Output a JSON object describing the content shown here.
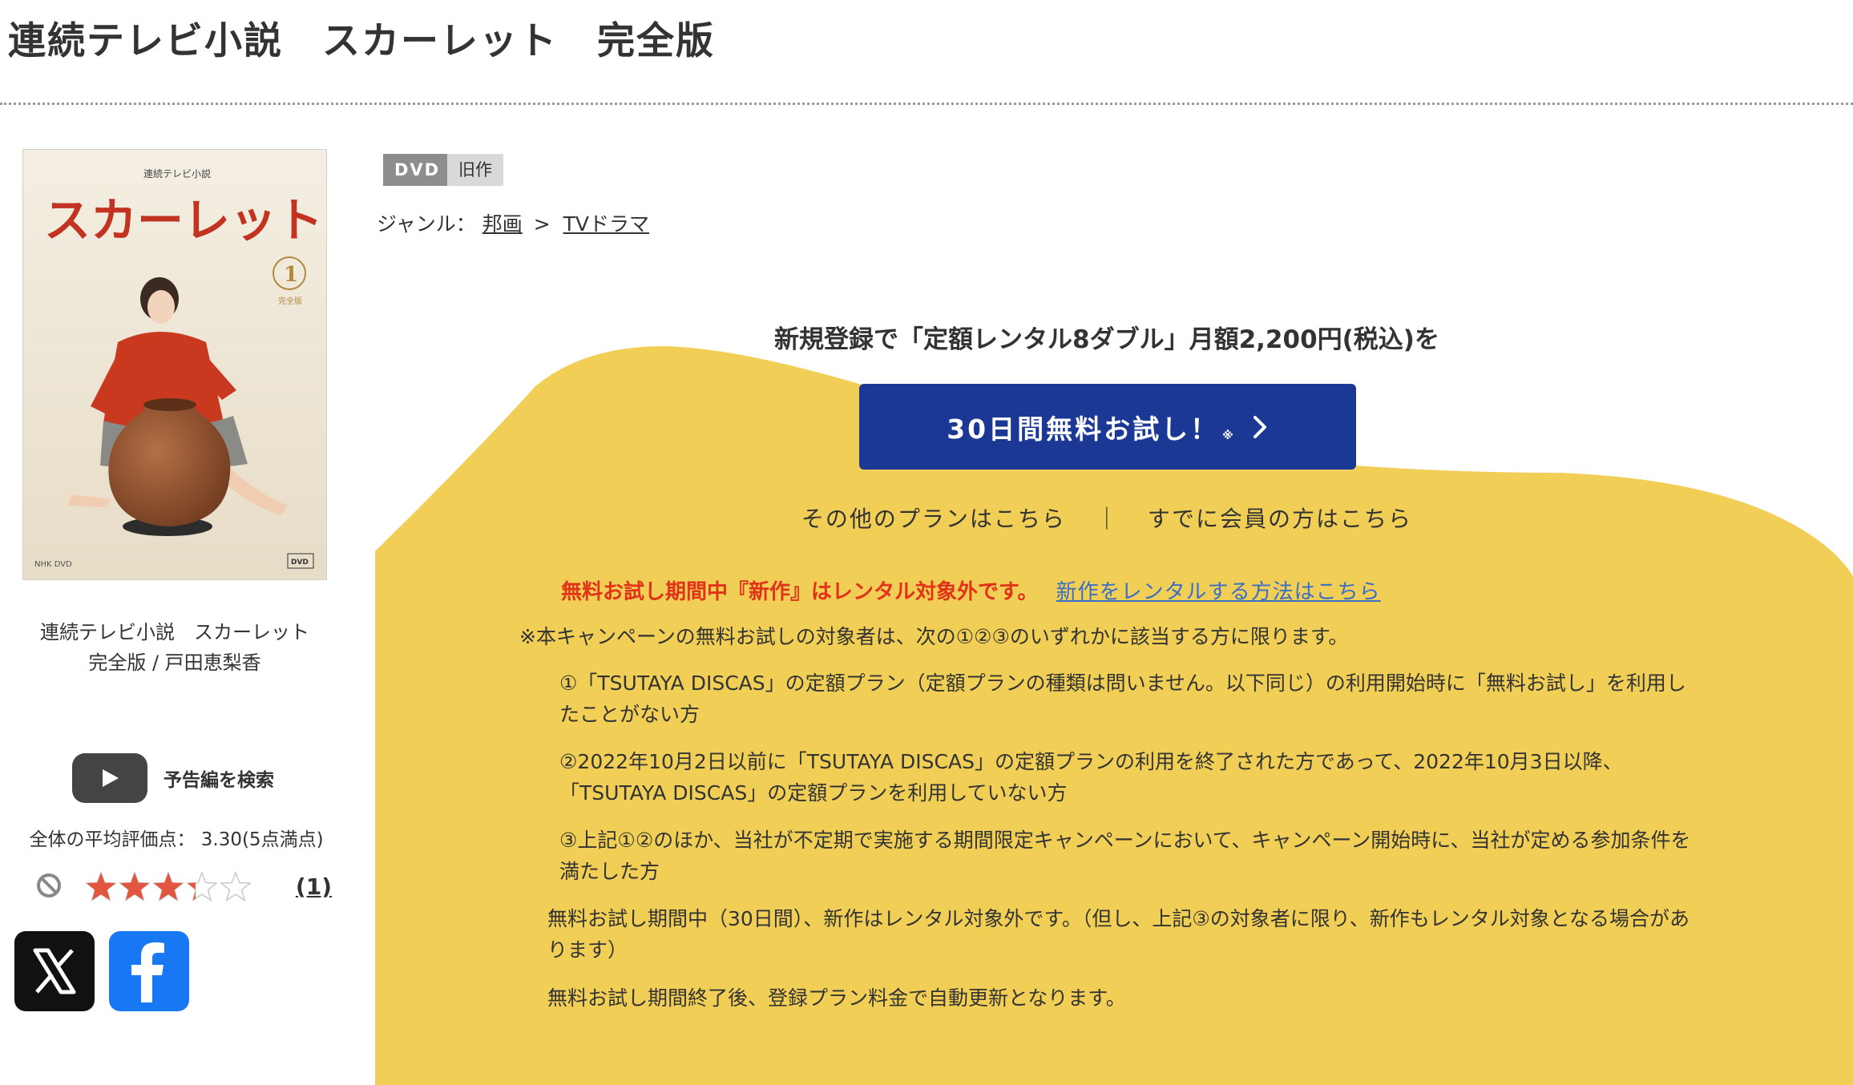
{
  "page": {
    "title": "連続テレビ小説　スカーレット　完全版"
  },
  "product": {
    "cover": {
      "series_label": "連続テレビ小説",
      "title": "スカーレット",
      "volume": "1",
      "edition": "完全版"
    },
    "name_line1": "連続テレビ小説　スカーレット",
    "name_line2": "完全版 / 戸田恵梨香",
    "trailer_label": "予告編を検索",
    "average_rating_label": "全体の平均評価点： 3.30(5点満点)",
    "rating_value": 3.3,
    "rating_max": 5,
    "review_count": "(1)",
    "share": [
      {
        "name": "x-share-icon"
      },
      {
        "name": "facebook-share-icon"
      }
    ]
  },
  "tags": [
    "DVD",
    "旧作"
  ],
  "genre": {
    "label": "ジャンル：",
    "items": [
      "邦画",
      "TVドラマ"
    ],
    "separator": ">"
  },
  "promo": {
    "heading": "新規登録で「定額レンタル8ダブル」月額2,200円(税込)を",
    "button_label": "30日間無料お試し！",
    "button_mark": "※",
    "other_plans_link": "その他のプランはこちら",
    "divider": "｜",
    "member_link": "すでに会員の方はこちら",
    "warning_text": "無料お試し期間中『新作』はレンタル対象外です。",
    "warning_link": "新作をレンタルする方法はこちら",
    "notice_intro": "※本キャンペーンの無料お試しの対象者は、次の①②③のいずれかに該当する方に限ります。",
    "conditions": [
      "①「TSUTAYA DISCAS」の定額プラン（定額プランの種類は問いません。以下同じ）の利用開始時に「無料お試し」を利用したことがない方",
      "②2022年10月2日以前に「TSUTAYA DISCAS」の定額プランの利用を終了された方であって、2022年10月3日以降、「TSUTAYA DISCAS」の定額プランを利用していない方",
      "③上記①②のほか、当社が不定期で実施する期間限定キャンペーンにおいて、キャンペーン開始時に、当社が定める参加条件を満たした方"
    ],
    "note_new_titles": "無料お試し期間中（30日間）、新作はレンタル対象外です。（但し、上記③の対象者に限り、新作もレンタル対象となる場合があります）",
    "note_auto_renew": "無料お試し期間終了後、登録プラン料金で自動更新となります。"
  },
  "colors": {
    "promo_bg": "#f1cf57",
    "button_bg": "#1b3895",
    "warning": "#e0331a",
    "link": "#3b6fc4",
    "tag_dvd": "#8d8d8d",
    "tag_old": "#d9d9d9",
    "star_fill": "#e2553f"
  }
}
